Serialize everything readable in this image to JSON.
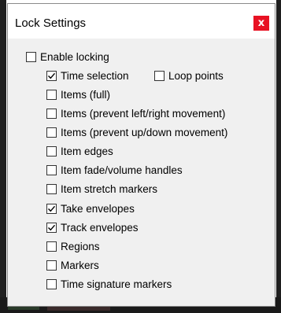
{
  "dialog": {
    "title": "Lock Settings",
    "close_label": "x"
  },
  "options": [
    {
      "label": "Enable locking",
      "checked": false
    },
    {
      "label": "Time selection",
      "checked": true
    },
    {
      "label": "Loop points",
      "checked": false
    },
    {
      "label": "Items (full)",
      "checked": false
    },
    {
      "label": "Items (prevent left/right movement)",
      "checked": false
    },
    {
      "label": "Items (prevent up/down movement)",
      "checked": false
    },
    {
      "label": "Item edges",
      "checked": false
    },
    {
      "label": "Item fade/volume handles",
      "checked": false
    },
    {
      "label": "Item stretch markers",
      "checked": false
    },
    {
      "label": "Take envelopes",
      "checked": true
    },
    {
      "label": "Track envelopes",
      "checked": true
    },
    {
      "label": "Regions",
      "checked": false
    },
    {
      "label": "Markers",
      "checked": false
    },
    {
      "label": "Time signature markers",
      "checked": false
    }
  ]
}
